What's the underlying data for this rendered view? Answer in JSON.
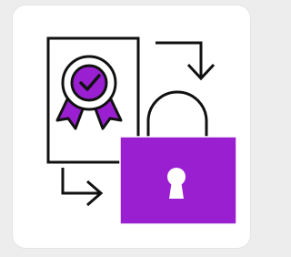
{
  "illustration": {
    "icons": [
      "certificate-document-icon",
      "award-badge-icon",
      "checkmark-icon",
      "padlock-icon",
      "keyhole-icon",
      "arrow-right-down-icon",
      "arrow-down-right-icon"
    ]
  },
  "colors": {
    "background": "#ededed",
    "card": "#ffffff",
    "accent": "#9a1fd0",
    "stroke": "#111111"
  }
}
